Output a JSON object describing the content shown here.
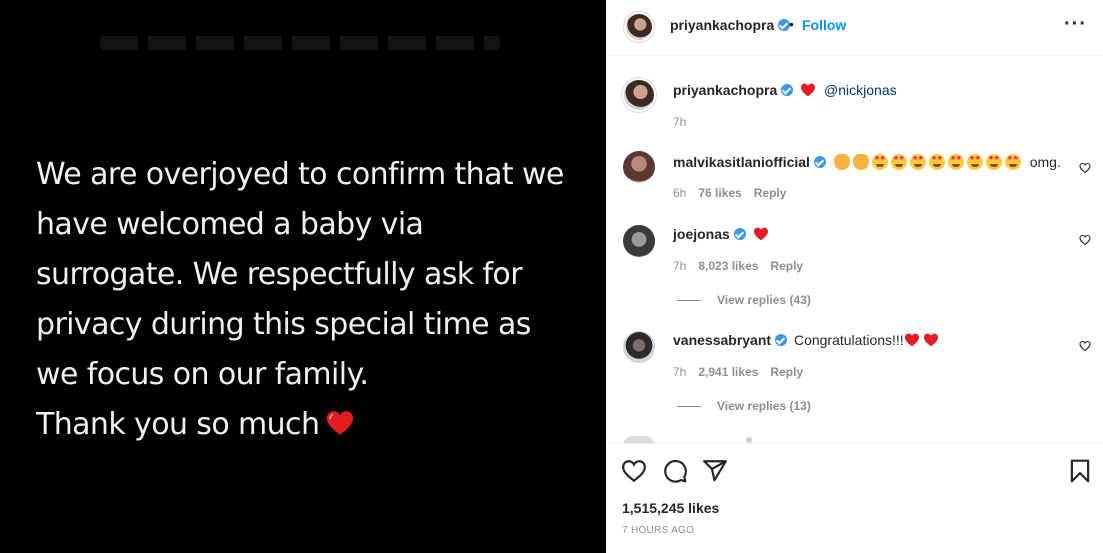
{
  "post": {
    "lines": [
      "We are overjoyed to confirm that we",
      "have welcomed a baby via",
      "surrogate. We respectfully ask for",
      "privacy during this special time as",
      "we focus on our family.",
      "Thank you so much"
    ]
  },
  "header": {
    "username": "priyankachopra",
    "separator": "•",
    "follow_label": "Follow",
    "more_label": "···"
  },
  "caption": {
    "username": "priyankachopra",
    "mention": "@nickjonas",
    "time": "7h"
  },
  "comments": [
    {
      "username": "malvikasitlaniofficial",
      "text": "omg.",
      "time": "6h",
      "likes": "76 likes",
      "reply": "Reply",
      "emojis": [
        "clap",
        "clap",
        "star",
        "star",
        "star",
        "star",
        "star",
        "star",
        "star",
        "star"
      ]
    },
    {
      "username": "joejonas",
      "text": "",
      "time": "7h",
      "likes": "8,023 likes",
      "reply": "Reply",
      "view_replies": "View replies (43)"
    },
    {
      "username": "vanessabryant",
      "text": "Congratulations!!!",
      "time": "7h",
      "likes": "2,941 likes",
      "reply": "Reply",
      "view_replies": "View replies (13)"
    }
  ],
  "footer": {
    "likes": "1,515,245 likes",
    "time_ago": "7 HOURS AGO"
  },
  "colors": {
    "accent": "#0095f6",
    "verified": "#3897f0",
    "heart": "#ed4956"
  }
}
